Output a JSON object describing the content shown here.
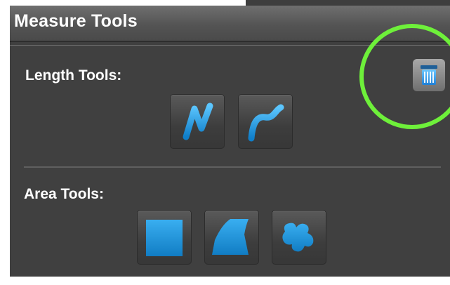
{
  "panel": {
    "title": "Measure Tools"
  },
  "length_section": {
    "label": "Length Tools:",
    "tools": [
      {
        "icon": "polyline-icon"
      },
      {
        "icon": "freehand-curve-icon"
      }
    ]
  },
  "area_section": {
    "label": "Area Tools:",
    "tools": [
      {
        "icon": "rectangle-icon"
      },
      {
        "icon": "polygon-icon"
      },
      {
        "icon": "freehand-shape-icon"
      }
    ]
  },
  "colors": {
    "panel_bg": "#404040",
    "header_bg": "#5a5a5a",
    "accent_blue": "#2aa3e6",
    "highlight_ring": "#6ef03a"
  }
}
